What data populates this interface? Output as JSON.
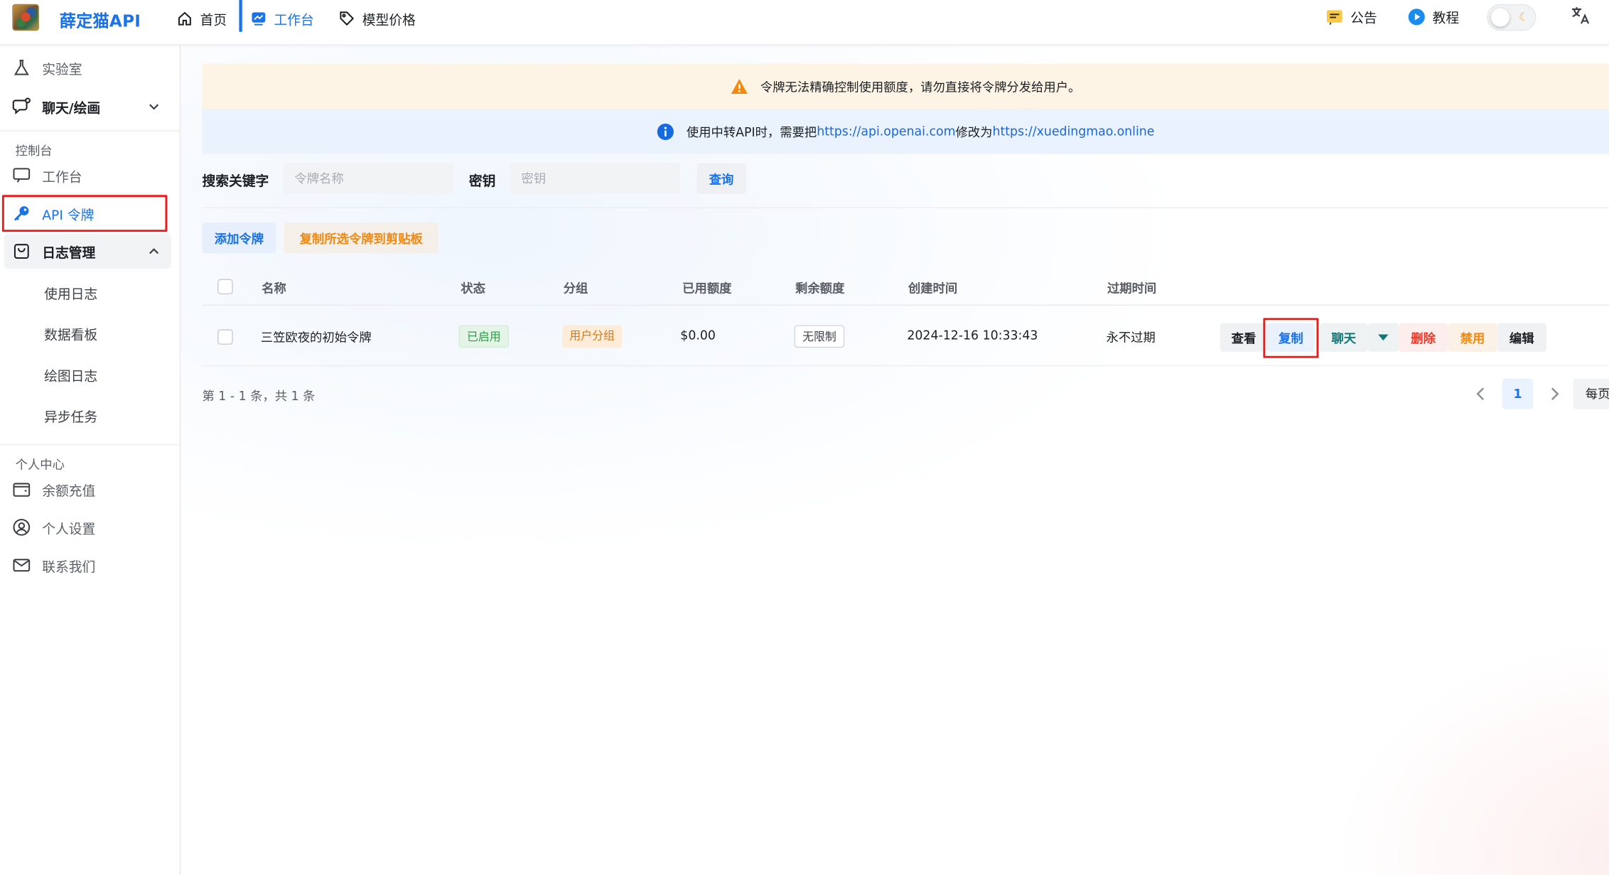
{
  "header": {
    "brand": "薛定猫API",
    "nav": [
      {
        "label": "首页",
        "icon": "home-icon"
      },
      {
        "label": "工作台",
        "icon": "workspace-icon",
        "active": true
      },
      {
        "label": "模型价格",
        "icon": "price-tag-icon"
      }
    ],
    "announcement_label": "公告",
    "tutorial_label": "教程",
    "theme_toggle": "light",
    "accent_color": "#1a73e8"
  },
  "sidebar": {
    "lab_label": "实验室",
    "chat_draw_label": "聊天/绘画",
    "console_group": "控制台",
    "workspace_label": "工作台",
    "api_token_label": "API 令牌",
    "log_mgmt_label": "日志管理",
    "log_items": [
      "使用日志",
      "数据看板",
      "绘图日志",
      "异步任务"
    ],
    "personal_group": "个人中心",
    "topup_label": "余额充值",
    "settings_label": "个人设置",
    "contact_label": "联系我们"
  },
  "banners": {
    "warning": "令牌无法精确控制使用额度，请勿直接将令牌分发给用户。",
    "info_prefix": "使用中转API时，需要把",
    "info_url1": "https://api.openai.com",
    "info_middle": "修改为",
    "info_url2": "https://xuedingmao.online"
  },
  "search": {
    "keyword_label": "搜索关键字",
    "keyword_placeholder": "令牌名称",
    "key_label": "密钥",
    "key_placeholder": "密钥",
    "query_button": "查询"
  },
  "actions": {
    "add_token": "添加令牌",
    "copy_selected": "复制所选令牌到剪贴板"
  },
  "table": {
    "headers": [
      "名称",
      "状态",
      "分组",
      "已用额度",
      "剩余额度",
      "创建时间",
      "过期时间"
    ],
    "rows": [
      {
        "name": "三笠欧夜的初始令牌",
        "status": "已启用",
        "group": "用户分组",
        "used": "$0.00",
        "remaining": "无限制",
        "created": "2024-12-16 10:33:43",
        "expires": "永不过期",
        "ops": {
          "view": "查看",
          "copy": "复制",
          "chat": "聊天",
          "delete": "删除",
          "disable": "禁用",
          "edit": "编辑"
        }
      }
    ]
  },
  "pagination": {
    "summary": "第 1 - 1 条，共 1 条",
    "current_page": "1",
    "page_size_label": "每页"
  }
}
